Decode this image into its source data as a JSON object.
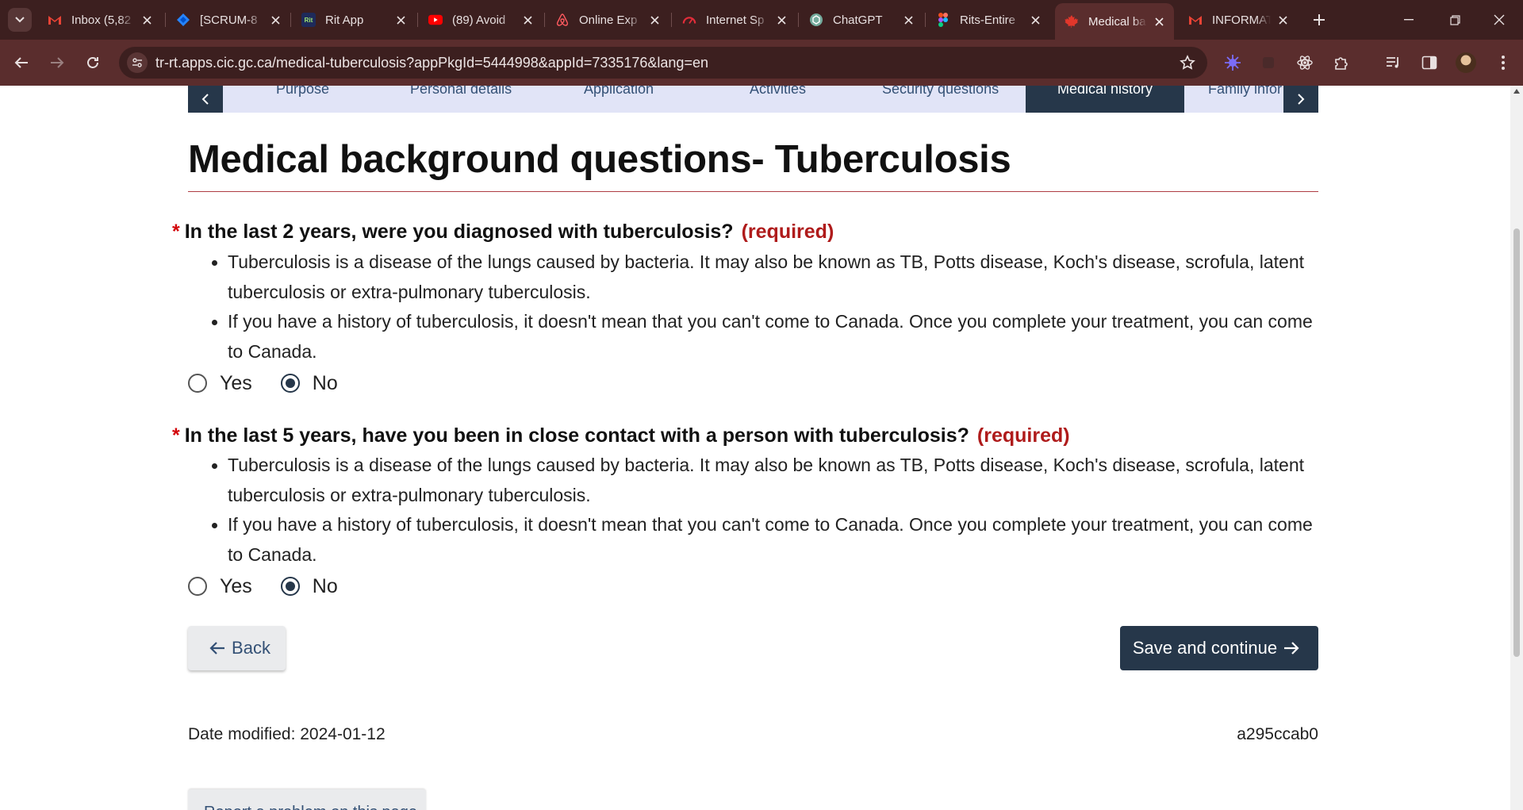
{
  "browser": {
    "tabs": [
      {
        "title": "Inbox (5,82",
        "icon": "gmail-icon"
      },
      {
        "title": "[SCRUM-8",
        "icon": "jira-icon"
      },
      {
        "title": "Rit App",
        "icon": "rit-icon",
        "icon_text": "Rit"
      },
      {
        "title": "(89) Avoid",
        "icon": "youtube-icon"
      },
      {
        "title": "Online Exp",
        "icon": "airbnb-icon"
      },
      {
        "title": "Internet Sp",
        "icon": "speedtest-icon"
      },
      {
        "title": "ChatGPT",
        "icon": "chatgpt-icon"
      },
      {
        "title": "Rits-Entire",
        "icon": "figma-icon"
      },
      {
        "title": "Medical ba",
        "icon": "canada-flag-icon",
        "active": true
      },
      {
        "title": "INFORMAT",
        "icon": "gmail-icon"
      }
    ],
    "url": "tr-rt.apps.cic.gc.ca/medical-tuberculosis?appPkgId=5444998&appId=7335176&lang=en",
    "colors": {
      "frame": "#3c1f1f",
      "toolbar": "#5a2d2d"
    }
  },
  "stepnav": {
    "steps": [
      "Purpose",
      "Personal details",
      "Application",
      "Activities",
      "Security questions",
      "Medical history",
      "Family infor"
    ],
    "active": "Medical history",
    "color": "#26374a"
  },
  "page": {
    "title": "Medical background questions- Tuberculosis",
    "questions": [
      {
        "star": "*",
        "label": "In the last 2 years, were you diagnosed with tuberculosis?",
        "required": "(required)",
        "bullets": [
          "Tuberculosis is a disease of the lungs caused by bacteria. It may also be known as TB, Potts disease, Koch's disease, scrofula, latent tuberculosis or extra-pulmonary tuberculosis.",
          "If you have a history of tuberculosis, it doesn't mean that you can't come to Canada. Once you complete your treatment, you can come to Canada."
        ],
        "options": [
          "Yes",
          "No"
        ],
        "selected": "No"
      },
      {
        "star": "*",
        "label": "In the last 5 years, have you been in close contact with a person with tuberculosis?",
        "required": "(required)",
        "bullets": [
          "Tuberculosis is a disease of the lungs caused by bacteria. It may also be known as TB, Potts disease, Koch's disease, scrofula, latent tuberculosis or extra-pulmonary tuberculosis.",
          "If you have a history of tuberculosis, it doesn't mean that you can't come to Canada. Once you complete your treatment, you can come to Canada."
        ],
        "options": [
          "Yes",
          "No"
        ],
        "selected": "No"
      }
    ],
    "back_label": "Back",
    "save_label": "Save and continue",
    "date_modified": "Date modified: 2024-01-12",
    "version": "a295ccab0",
    "report_label": "Report a problem on this page"
  }
}
